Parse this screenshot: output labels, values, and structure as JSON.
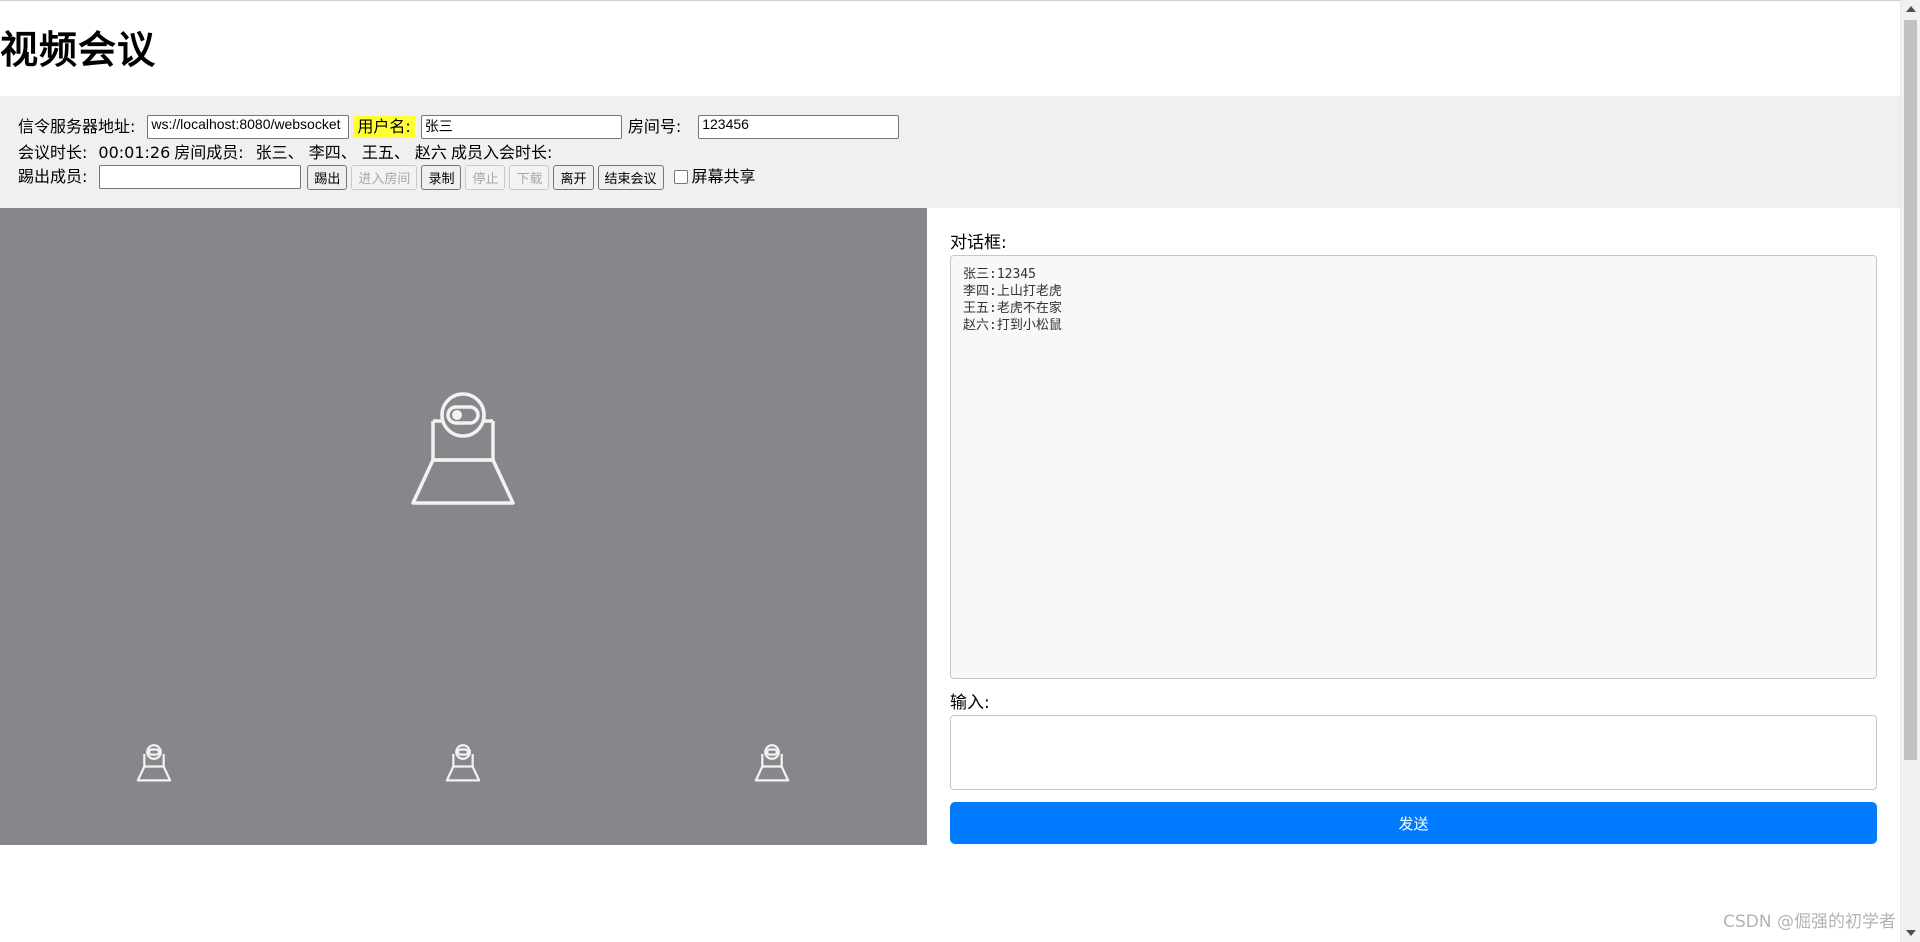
{
  "page": {
    "title": "视频会议"
  },
  "controls": {
    "signal_server_label": "信令服务器地址:",
    "signal_server_value": "ws://localhost:8080/websocket",
    "username_label": "用户名:",
    "username_value": "张三",
    "room_label": "房间号:",
    "room_value": "123456",
    "meeting_duration_label": "会议时长:",
    "meeting_duration_value": "00:01:26",
    "room_members_label": "房间成员:",
    "room_members_value": "张三、 李四、 王五、 赵六",
    "member_join_duration_label": "成员入会时长:",
    "kick_member_label": "踢出成员:",
    "kick_member_value": "",
    "buttons": {
      "kick": "踢出",
      "enter_room": "进入房间",
      "record": "录制",
      "stop": "停止",
      "download": "下载",
      "leave": "离开",
      "end_meeting": "结束会议"
    },
    "screen_share_label": "屏幕共享",
    "screen_share_checked": false
  },
  "video": {
    "main_icon": "webcam-icon",
    "thumb_icons": [
      "webcam-icon",
      "webcam-icon",
      "webcam-icon"
    ],
    "background_color": "#88868a"
  },
  "chat": {
    "dialog_label": "对话框:",
    "messages": [
      "张三:12345",
      "李四:上山打老虎",
      "王五:老虎不在家",
      "赵六:打到小松鼠"
    ],
    "input_label": "输入:",
    "input_value": "",
    "send_label": "发送",
    "send_color": "#007bff"
  },
  "watermark": "CSDN @倔强的初学者"
}
